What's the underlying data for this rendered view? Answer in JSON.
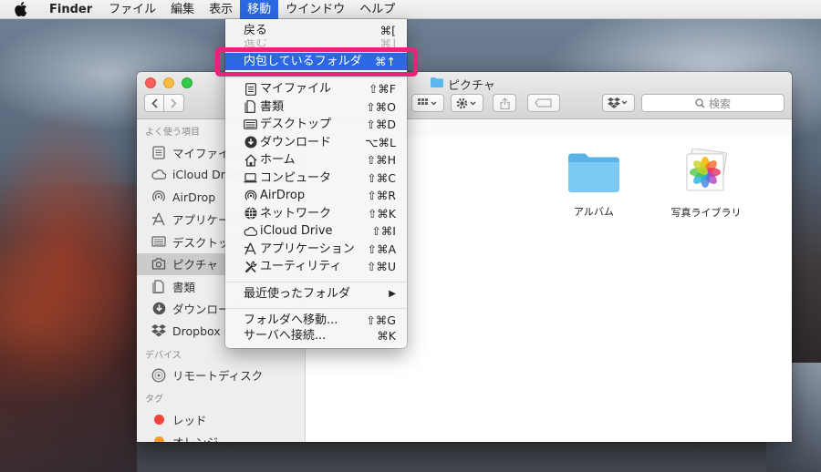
{
  "menubar": {
    "app_name": "Finder",
    "items": [
      "ファイル",
      "編集",
      "表示",
      "移動",
      "ウインドウ",
      "ヘルプ"
    ]
  },
  "window": {
    "title": "ピクチャ",
    "search_placeholder": "検索"
  },
  "sidebar": {
    "favorites_header": "よく使う項目",
    "favorites": [
      {
        "label": "マイファイル",
        "icon": "all-my-files-icon"
      },
      {
        "label": "iCloud Drive",
        "icon": "icloud-icon"
      },
      {
        "label": "AirDrop",
        "icon": "airdrop-icon"
      },
      {
        "label": "アプリケーション",
        "icon": "applications-icon"
      },
      {
        "label": "デスクトップ",
        "icon": "desktop-icon"
      },
      {
        "label": "ピクチャ",
        "icon": "camera-icon",
        "selected": true
      },
      {
        "label": "書類",
        "icon": "documents-icon"
      },
      {
        "label": "ダウンロード",
        "icon": "downloads-icon"
      },
      {
        "label": "Dropbox",
        "icon": "dropbox-icon"
      }
    ],
    "devices_header": "デバイス",
    "devices": [
      {
        "label": "リモートディスク",
        "icon": "remote-disc-icon"
      }
    ],
    "tags_header": "タグ",
    "tags": [
      {
        "label": "レッド",
        "color": "#f0433a"
      },
      {
        "label": "オレンジ",
        "color": "#f79a2b"
      }
    ]
  },
  "files": [
    {
      "label": "アルバム",
      "icon": "folder-icon"
    },
    {
      "label": "写真ライブラリ",
      "icon": "photos-library-icon"
    }
  ],
  "go_menu": {
    "items": [
      {
        "label": "戻る",
        "shortcut": "⌘["
      },
      {
        "label": "進む",
        "shortcut": "⌘]",
        "disabled": true
      },
      {
        "label": "内包しているフォルダ",
        "shortcut": "⌘↑",
        "highlighted": true
      },
      {
        "label": "マイファイル",
        "shortcut": "⇧⌘F",
        "icon": "all-my-files-icon"
      },
      {
        "label": "書類",
        "shortcut": "⇧⌘O",
        "icon": "documents-icon"
      },
      {
        "label": "デスクトップ",
        "shortcut": "⇧⌘D",
        "icon": "desktop-icon"
      },
      {
        "label": "ダウンロード",
        "shortcut": "⌥⌘L",
        "icon": "downloads-icon"
      },
      {
        "label": "ホーム",
        "shortcut": "⇧⌘H",
        "icon": "home-icon"
      },
      {
        "label": "コンピュータ",
        "shortcut": "⇧⌘C",
        "icon": "computer-icon"
      },
      {
        "label": "AirDrop",
        "shortcut": "⇧⌘R",
        "icon": "airdrop-icon"
      },
      {
        "label": "ネットワーク",
        "shortcut": "⇧⌘K",
        "icon": "network-icon"
      },
      {
        "label": "iCloud Drive",
        "shortcut": "⇧⌘I",
        "icon": "icloud-icon"
      },
      {
        "label": "アプリケーション",
        "shortcut": "⇧⌘A",
        "icon": "applications-icon"
      },
      {
        "label": "ユーティリティ",
        "shortcut": "⇧⌘U",
        "icon": "utilities-icon"
      },
      {
        "label": "最近使ったフォルダ",
        "shortcut": "▶"
      },
      {
        "label": "フォルダへ移動...",
        "shortcut": "⇧⌘G"
      },
      {
        "label": "サーバへ接続...",
        "shortcut": "⌘K"
      }
    ]
  },
  "colors": {
    "menu_highlight": "#2d68e4",
    "annotation_box": "#e8247a",
    "folder": "#6ec3f0"
  }
}
